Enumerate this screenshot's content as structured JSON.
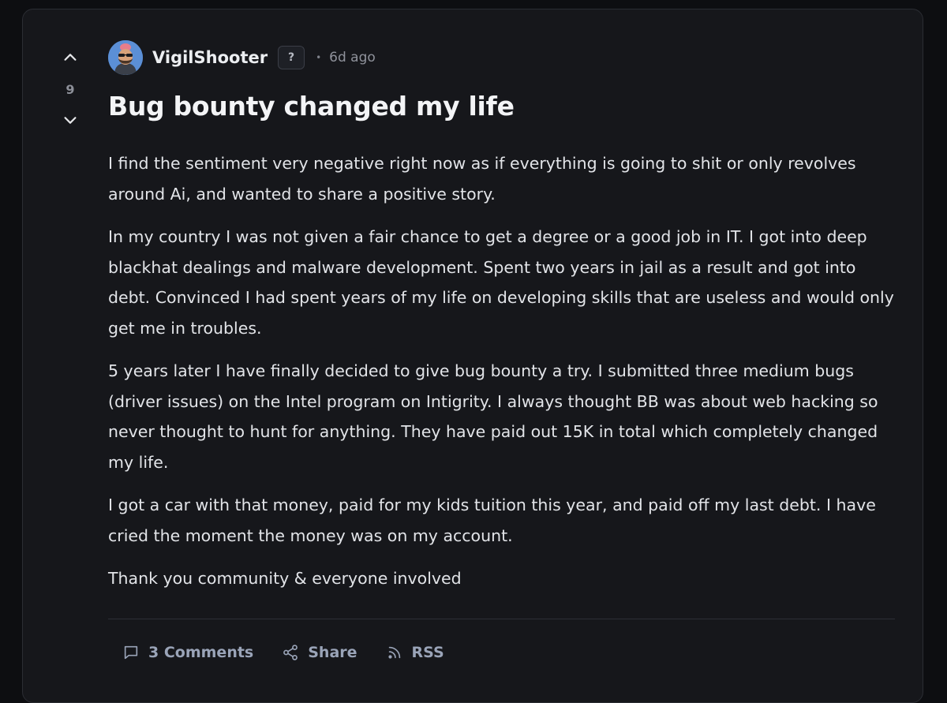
{
  "post": {
    "score": "9",
    "author": "VigilShooter",
    "badge": "?",
    "separator": "•",
    "time_ago": "6d ago",
    "title": "Bug bounty changed my life",
    "paragraphs": [
      "I find the sentiment very negative right now as if everything is going to shit or only revolves around Ai, and wanted to share a positive story.",
      "In my country I was not given a fair chance to get a degree or a good job in IT. I got into deep blackhat dealings and malware development. Spent two years in jail as a result and got into debt. Convinced I had spent years of my life on developing skills that are useless and would only get me in troubles.",
      "5 years later I have finally decided to give bug bounty a try. I submitted three medium bugs (driver issues) on the Intel program on Intigrity. I always thought BB was about web hacking so never thought to hunt for anything. They have paid out 15K in total which completely changed my life.",
      "I got a car with that money, paid for my kids tuition this year, and paid off my last debt. I have cried the moment the money was on my account.",
      "Thank you community & everyone involved"
    ]
  },
  "actions": {
    "comments_label": "3 Comments",
    "share_label": "Share",
    "rss_label": "RSS"
  },
  "icons": {
    "upvote": "chevron-up-icon",
    "downvote": "chevron-down-icon",
    "comments": "comment-icon",
    "share": "share-icon",
    "rss": "rss-icon"
  },
  "colors": {
    "page_background": "#0d0e11",
    "card_background": "#16171b",
    "action_text": "#9aa4b8",
    "avatar_background": "#5b8fd6"
  }
}
